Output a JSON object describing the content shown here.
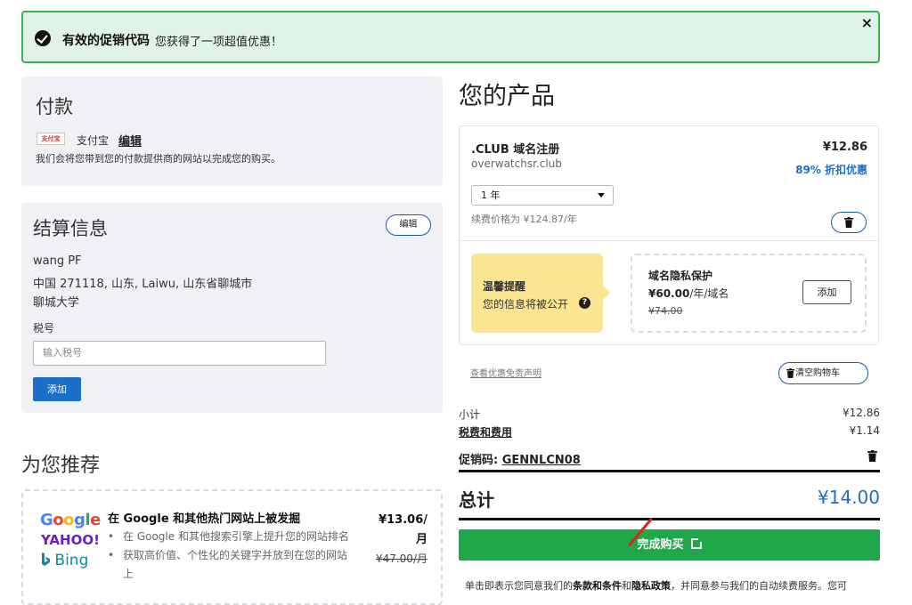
{
  "promo_banner": {
    "title": "有效的促销代码",
    "message": "您获得了一项超值优惠！",
    "close": "×"
  },
  "payment": {
    "title": "付款",
    "logo_text": "支付宝",
    "method": "支付宝",
    "edit": "编辑",
    "note": "我们会将您带到您的付款提供商的网站以完成您的购买。"
  },
  "billing": {
    "title": "结算信息",
    "edit": "编辑",
    "name": "wang PF",
    "address": "中国 271118, 山东, Laiwu, 山东省聊城市",
    "org": "聊城大学",
    "tax_label": "税号",
    "tax_placeholder": "输入税号",
    "add_button": "添加"
  },
  "recommend": {
    "title": "为您推荐",
    "logos": {
      "google": "Google",
      "yahoo": "YAHOO!",
      "bing": "Bing"
    },
    "heading": "在 Google 和其他热门网站上被发掘",
    "bullets": [
      "在 Google 和其他搜索引擎上提升您的网站排名",
      "获取高价值、个性化的关键字并放到在您的网站上"
    ],
    "price": "¥13.06/月",
    "price_line1": "¥13.06/",
    "price_line2": "月",
    "old_price": "¥47.00/月"
  },
  "products": {
    "title": "您的产品",
    "item": {
      "name": ".CLUB 域名注册",
      "domain": "overwatchsr.club",
      "price": "¥12.86",
      "discount": "89% 折扣优惠",
      "term": "1 年",
      "renewal": "续费价格为 ¥124.87/年"
    },
    "tip": {
      "title": "温馨提醒",
      "text": "您的信息将被公开"
    },
    "privacy": {
      "title": "域名隐私保护",
      "price": "¥60.00",
      "unit": "/年/域名",
      "old_price": "¥74.00",
      "add": "添加"
    }
  },
  "disclaimer": "查看优惠免责声明",
  "clear_cart": "清空购物车",
  "summary": {
    "subtotal_label": "小计",
    "subtotal": "¥12.86",
    "tax_label": "税费和费用",
    "tax": "¥1.14",
    "promo_label": "促销码:",
    "promo_code": "GENNLCN08",
    "total_label": "总计",
    "total": "¥14.00"
  },
  "checkout": "完成购买",
  "legal": {
    "t1": "单击即表示您同意我们的",
    "terms": "条款和条件",
    "and": "和",
    "privacy": "隐私政策",
    "t2": "，并同意参与我们的自动续费服务。您可"
  },
  "colors": {
    "accent": "#1c6fc9",
    "success": "#1fa84a",
    "banner_bg": "#dff3e7",
    "tip_bg": "#fbe590"
  }
}
